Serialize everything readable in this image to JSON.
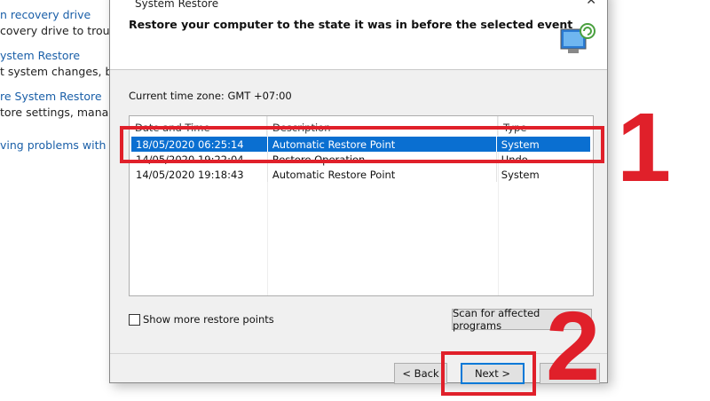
{
  "background_panel": {
    "items": [
      {
        "link": "n recovery drive",
        "desc": "covery drive to troubles"
      },
      {
        "link": "ystem Restore",
        "desc": "t system changes, but"
      },
      {
        "link": "re System Restore",
        "desc": "tore settings, manage d"
      },
      {
        "link": "ving problems with you",
        "desc": ""
      }
    ]
  },
  "dialog": {
    "title": "System Restore",
    "heading": "Restore your computer to the state it was in before the selected event",
    "timezone": "Current time zone: GMT +07:00",
    "columns": [
      "Date and Time",
      "Description",
      "Type"
    ],
    "rows": [
      {
        "date": "18/05/2020 06:25:14",
        "description": "Automatic Restore Point",
        "type": "System",
        "selected": true
      },
      {
        "date": "14/05/2020 19:22:04",
        "description": "Restore Operation",
        "type": "Undo",
        "selected": false
      },
      {
        "date": "14/05/2020 19:18:43",
        "description": "Automatic Restore Point",
        "type": "System",
        "selected": false
      }
    ],
    "show_more_label": "Show more restore points",
    "show_more_checked": false,
    "scan_button": "Scan for affected programs",
    "back_button": "< Back",
    "next_button": "Next >",
    "cancel_button": "Cancel"
  },
  "annotations": {
    "step1": "1",
    "step2": "2",
    "color": "#e0202a"
  }
}
